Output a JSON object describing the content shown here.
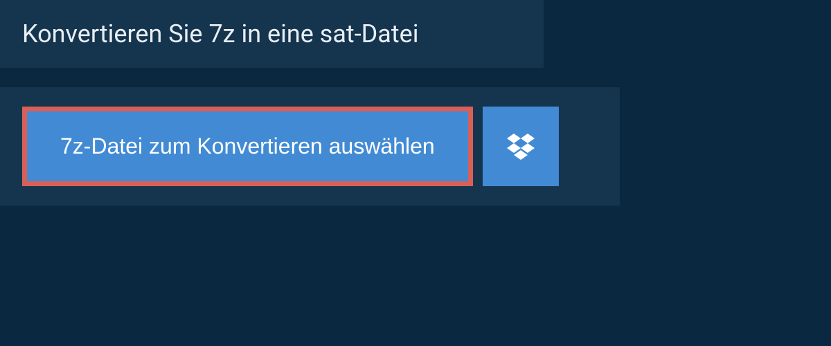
{
  "header": {
    "title": "Konvertieren Sie 7z in eine sat-Datei"
  },
  "actions": {
    "select_file_label": "7z-Datei zum Konvertieren auswählen"
  }
}
